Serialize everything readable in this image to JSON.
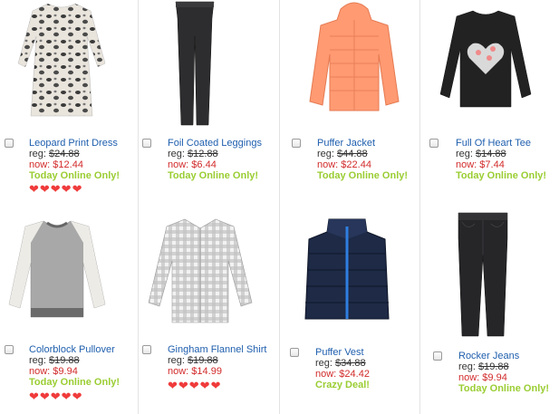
{
  "colors": {
    "link": "#1f5fae",
    "sale": "#d22a2a",
    "promo": "#9acd32",
    "heart": "#f03b3b"
  },
  "reg_prefix": "reg: ",
  "now_prefix": "now: ",
  "products": [
    {
      "name": "Leopard Print Dress",
      "reg": "$24.88",
      "now": "$12.44",
      "promo": "Today Online Only!",
      "hearts": "❤❤❤❤❤",
      "image": "leopard-dress-icon"
    },
    {
      "name": "Foil Coated Leggings",
      "reg": "$12.88",
      "now": "$6.44",
      "promo": "Today Online Only!",
      "hearts": "",
      "image": "leggings-icon"
    },
    {
      "name": "Puffer Jacket",
      "reg": "$44.88",
      "now": "$22.44",
      "promo": "Today Online Only!",
      "hearts": "",
      "image": "puffer-jacket-icon"
    },
    {
      "name": "Full Of Heart Tee",
      "reg": "$14.88",
      "now": "$7.44",
      "promo": "Today Online Only!",
      "hearts": "",
      "image": "heart-tee-icon"
    },
    {
      "name": "Colorblock Pullover",
      "reg": "$19.88",
      "now": "$9.94",
      "promo": "Today Online Only!",
      "hearts": "❤❤❤❤❤",
      "image": "pullover-icon"
    },
    {
      "name": "Gingham Flannel Shirt",
      "reg": "$19.88",
      "now": "$14.99",
      "promo": "",
      "hearts": "❤❤❤❤❤",
      "image": "gingham-shirt-icon"
    },
    {
      "name": "Puffer Vest",
      "reg": "$34.88",
      "now": "$24.42",
      "promo": "Crazy Deal!",
      "hearts": "",
      "image": "puffer-vest-icon"
    },
    {
      "name": "Rocker Jeans",
      "reg": "$19.88",
      "now": "$9.94",
      "promo": "Today Online Only!",
      "hearts": "",
      "image": "jeans-icon"
    }
  ]
}
